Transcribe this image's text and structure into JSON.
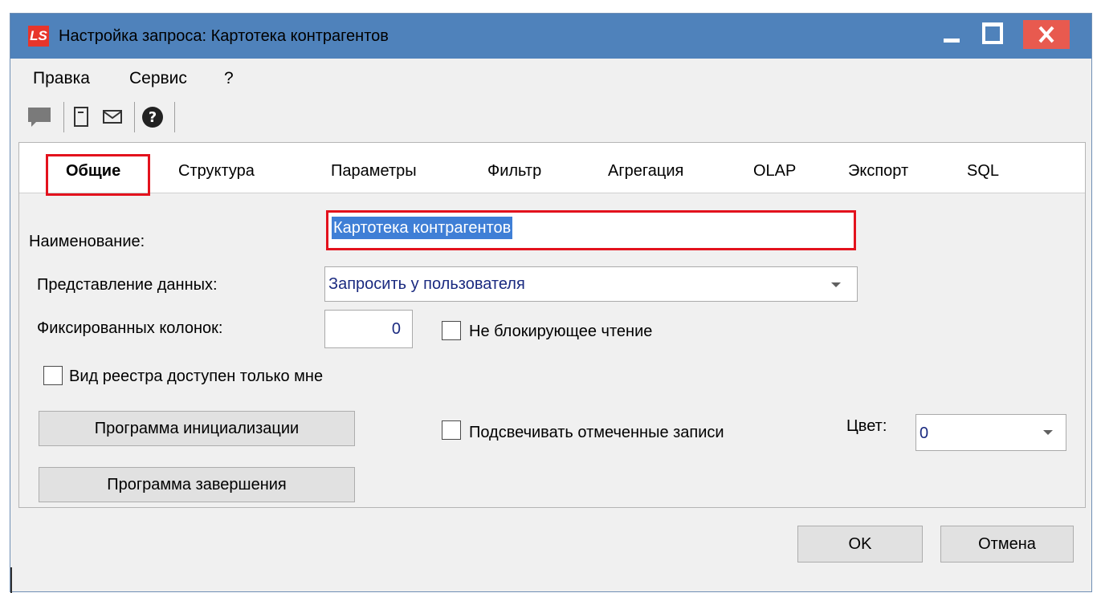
{
  "window": {
    "icon_text": "LS",
    "title": "Настройка запроса: Картотека контрагентов"
  },
  "menu": [
    "Правка",
    "Сервис",
    "?"
  ],
  "toolbar": {
    "icons": [
      "chat-icon",
      "card-icon",
      "mail-icon",
      "help-icon"
    ]
  },
  "tabs": [
    {
      "label": "Общие",
      "active": true
    },
    {
      "label": "Структура"
    },
    {
      "label": "Параметры"
    },
    {
      "label": "Фильтр"
    },
    {
      "label": "Агрегация"
    },
    {
      "label": "OLAP"
    },
    {
      "label": "Экспорт"
    },
    {
      "label": "SQL"
    }
  ],
  "form": {
    "name_label": "Наименование:",
    "name_value": "Картотека контрагентов",
    "view_label": "Представление данных:",
    "view_value": "Запросить у пользователя",
    "fixed_cols_label": "Фиксированных колонок:",
    "fixed_cols_value": "0",
    "nonblocking_label": "Не блокирующее чтение",
    "nonblocking_checked": false,
    "registry_only_me_label": "Вид реестра доступен только мне",
    "registry_only_me_checked": false,
    "init_program_button": "Программа инициализации",
    "finish_program_button": "Программа завершения",
    "highlight_label": "Подсвечивать отмеченные записи",
    "highlight_checked": false,
    "color_label": "Цвет:",
    "color_value": "0"
  },
  "footer": {
    "ok_button": "OK",
    "cancel_button": "Отмена"
  },
  "colors": {
    "titlebar": "#4f82bb",
    "close_button": "#e85a4f",
    "highlight_box": "#e3121d",
    "selection": "#3f7fd6"
  }
}
